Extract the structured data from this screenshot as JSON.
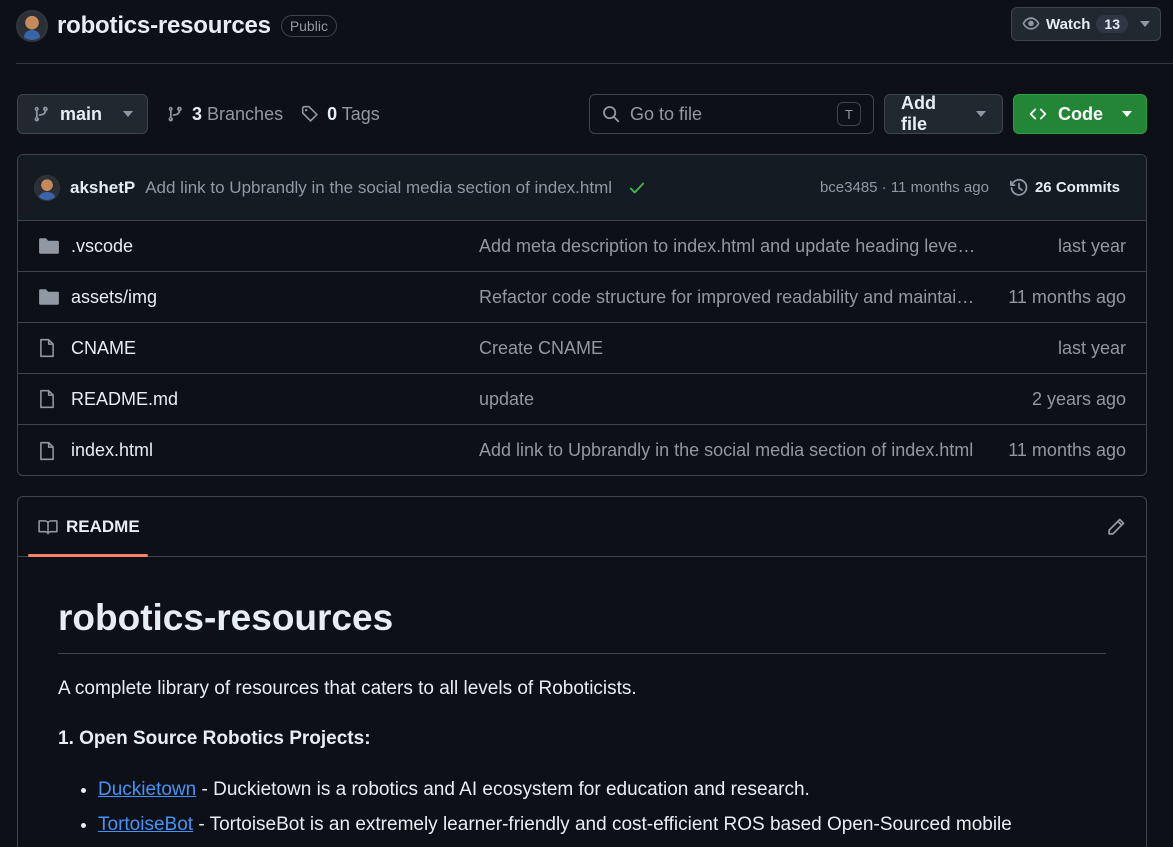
{
  "header": {
    "repo_name": "robotics-resources",
    "visibility": "Public",
    "watch_label": "Watch",
    "watch_count": "13"
  },
  "toolbar": {
    "branch": "main",
    "branches_count": "3",
    "branches_label": "Branches",
    "tags_count": "0",
    "tags_label": "Tags",
    "search_placeholder": "Go to file",
    "search_shortcut": "T",
    "add_file_label": "Add file",
    "code_label": "Code"
  },
  "latest_commit": {
    "author": "akshetP",
    "message": "Add link to Upbrandly in the social media section of index.html",
    "sha_time": "bce3485 · 11 months ago",
    "commits_count": "26 Commits"
  },
  "files": [
    {
      "type": "folder",
      "name": ".vscode",
      "message": "Add meta description to index.html and update heading level…",
      "date": "last year"
    },
    {
      "type": "folder",
      "name": "assets/img",
      "message": "Refactor code structure for improved readability and maintai…",
      "date": "11 months ago"
    },
    {
      "type": "file",
      "name": "CNAME",
      "message": "Create CNAME",
      "date": "last year"
    },
    {
      "type": "file",
      "name": "README.md",
      "message": "update",
      "date": "2 years ago"
    },
    {
      "type": "file",
      "name": "index.html",
      "message": "Add link to Upbrandly in the social media section of index.html",
      "date": "11 months ago"
    }
  ],
  "readme": {
    "tab_label": "README",
    "title": "robotics-resources",
    "intro": "A complete library of resources that caters to all levels of Roboticists.",
    "section_heading": "1. Open Source Robotics Projects:",
    "items": [
      {
        "link": "Duckietown",
        "text": " - Duckietown is a robotics and AI ecosystem for education and research."
      },
      {
        "link": "TortoiseBot",
        "text": " - TortoiseBot is an extremely learner-friendly and cost-efficient ROS based Open-Sourced mobile"
      }
    ]
  },
  "colors": {
    "background": "#0d1117",
    "border": "#3d444d",
    "accent_green": "#238636",
    "link": "#4493f8",
    "tab_underline": "#f78166"
  }
}
